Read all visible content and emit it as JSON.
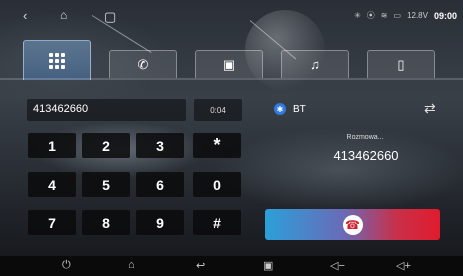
{
  "status_bar": {
    "back_icon": "back-icon",
    "home_icon": "home-outline-icon",
    "recent_icon": "recent-square-icon",
    "indicators": [
      "bluetooth-icon",
      "location-icon",
      "wifi-icon",
      "battery-icon"
    ],
    "voltage": "12.8V",
    "time": "09:00"
  },
  "tabs": [
    {
      "icon": "dialpad-icon",
      "active": true
    },
    {
      "icon": "call-history-icon",
      "active": false
    },
    {
      "icon": "contacts-icon",
      "active": false
    },
    {
      "icon": "bluetooth-music-icon",
      "active": false
    },
    {
      "icon": "phone-link-icon",
      "active": false
    }
  ],
  "dialer": {
    "number": "413462660",
    "duration": "0:04",
    "keys": [
      "1",
      "2",
      "3",
      "*",
      "4",
      "5",
      "6",
      "0",
      "7",
      "8",
      "9",
      "#"
    ]
  },
  "call_panel": {
    "bt_label": "BT",
    "status": "Rozmowa...",
    "number": "413462660"
  },
  "nav_bar": [
    "power-icon",
    "home-icon",
    "back-icon",
    "recents-icon",
    "volume-down-icon",
    "volume-up-icon"
  ],
  "colors": {
    "accent_blue": "#2f7be0",
    "hangup_start": "#2ba0d8",
    "hangup_end": "#e01c2c"
  }
}
